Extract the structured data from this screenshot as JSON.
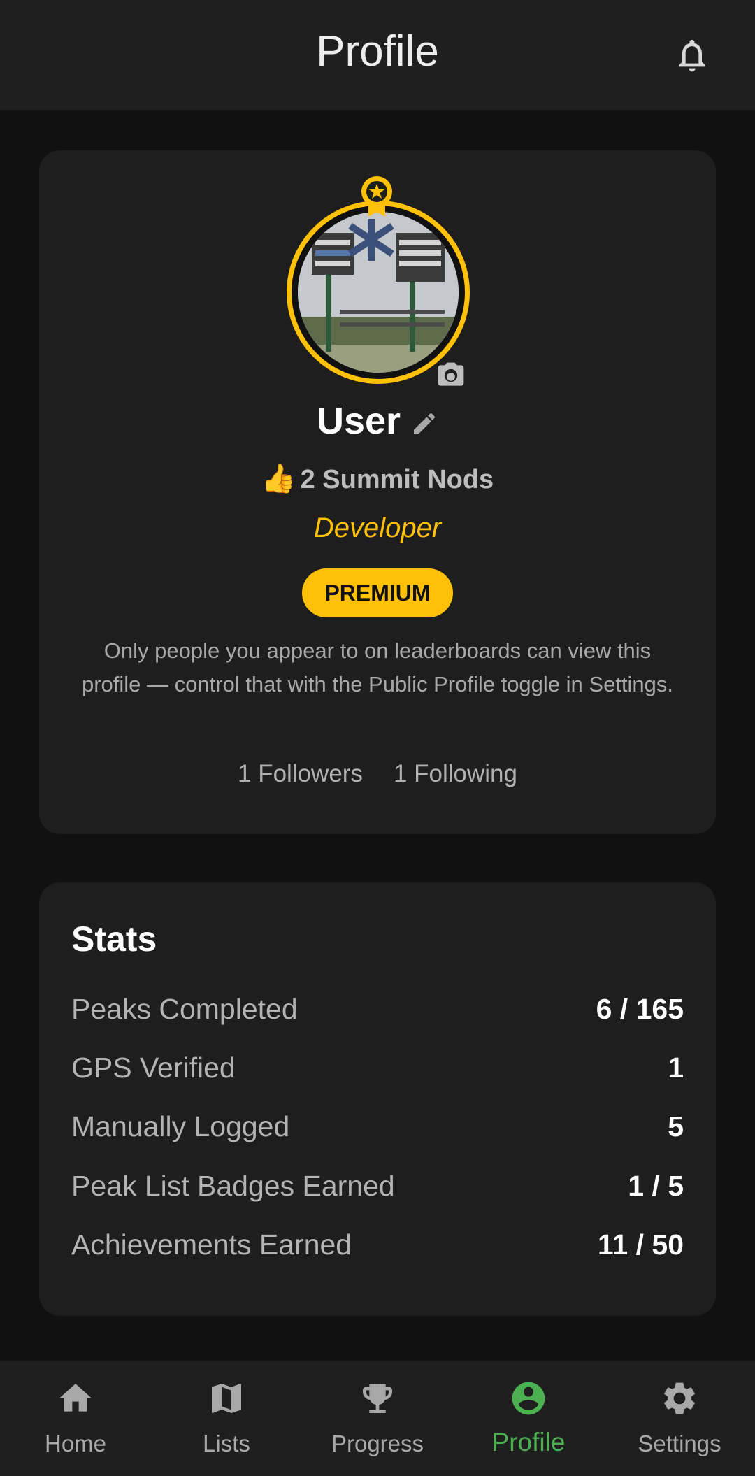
{
  "header": {
    "title": "Profile"
  },
  "profile": {
    "username": "User",
    "nods_emoji": "👍",
    "nods_text": "2 Summit Nods",
    "role": "Developer",
    "badge": "PREMIUM",
    "blurb": "Only people you appear to on leaderboards can view this profile — control that with the Public Profile toggle in Settings.",
    "followers": "1 Followers",
    "following": "1 Following"
  },
  "stats": {
    "title": "Stats",
    "rows": [
      {
        "label": "Peaks Completed",
        "value": "6 / 165"
      },
      {
        "label": "GPS Verified",
        "value": "1"
      },
      {
        "label": "Manually Logged",
        "value": "5"
      },
      {
        "label": "Peak List Badges Earned",
        "value": "1 / 5"
      },
      {
        "label": "Achievements Earned",
        "value": "11 / 50"
      }
    ]
  },
  "nav": [
    {
      "label": "Home",
      "icon": "home-icon"
    },
    {
      "label": "Lists",
      "icon": "map-icon"
    },
    {
      "label": "Progress",
      "icon": "trophy-icon"
    },
    {
      "label": "Profile",
      "icon": "account-circle-icon",
      "active": true
    },
    {
      "label": "Settings",
      "icon": "gear-icon"
    }
  ],
  "colors": {
    "accent": "#ffc107",
    "active_nav": "#4caf50",
    "card": "#1e1e1e",
    "background": "#111111"
  }
}
